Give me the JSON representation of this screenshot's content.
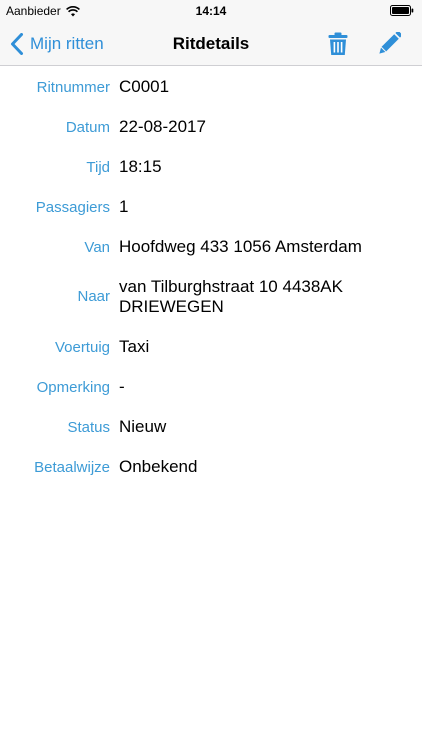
{
  "status_bar": {
    "carrier": "Aanbieder",
    "time": "14:14"
  },
  "nav": {
    "back_label": "Mijn ritten",
    "title": "Ritdetails",
    "icons": [
      "chevron-left-icon",
      "trash-icon",
      "pencil-icon"
    ],
    "accent_color": "#2f8fd8"
  },
  "details": [
    {
      "label": "Ritnummer",
      "value": "C0001"
    },
    {
      "label": "Datum",
      "value": "22-08-2017"
    },
    {
      "label": "Tijd",
      "value": "18:15"
    },
    {
      "label": "Passagiers",
      "value": "1"
    },
    {
      "label": "Van",
      "value": "Hoofdweg 433 1056 Amsterdam"
    },
    {
      "label": "Naar",
      "value": "van Tilburghstraat 10 4438AK DRIEWEGEN"
    },
    {
      "label": "Voertuig",
      "value": "Taxi"
    },
    {
      "label": "Opmerking",
      "value": "-"
    },
    {
      "label": "Status",
      "value": "Nieuw"
    },
    {
      "label": "Betaalwijze",
      "value": "Onbekend"
    }
  ],
  "label_color": "#3d9bd6"
}
